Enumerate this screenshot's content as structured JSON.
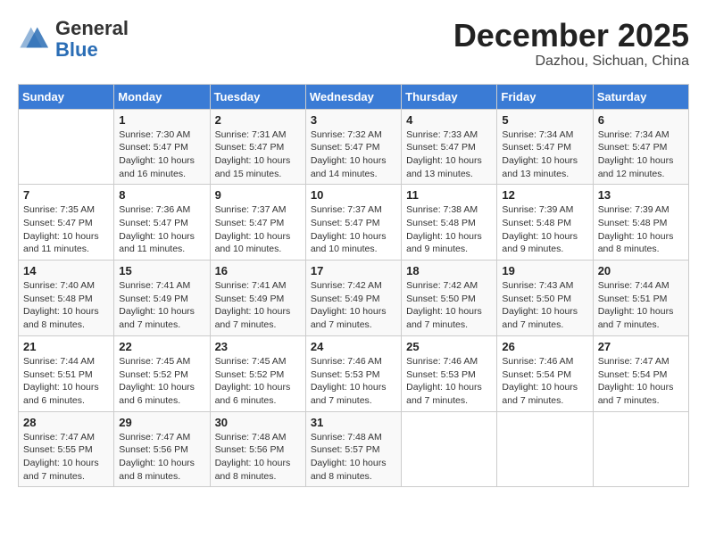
{
  "header": {
    "logo_line1": "General",
    "logo_line2": "Blue",
    "month": "December 2025",
    "location": "Dazhou, Sichuan, China"
  },
  "weekdays": [
    "Sunday",
    "Monday",
    "Tuesday",
    "Wednesday",
    "Thursday",
    "Friday",
    "Saturday"
  ],
  "weeks": [
    [
      {
        "day": "",
        "sunrise": "",
        "sunset": "",
        "daylight": ""
      },
      {
        "day": "1",
        "sunrise": "Sunrise: 7:30 AM",
        "sunset": "Sunset: 5:47 PM",
        "daylight": "Daylight: 10 hours and 16 minutes."
      },
      {
        "day": "2",
        "sunrise": "Sunrise: 7:31 AM",
        "sunset": "Sunset: 5:47 PM",
        "daylight": "Daylight: 10 hours and 15 minutes."
      },
      {
        "day": "3",
        "sunrise": "Sunrise: 7:32 AM",
        "sunset": "Sunset: 5:47 PM",
        "daylight": "Daylight: 10 hours and 14 minutes."
      },
      {
        "day": "4",
        "sunrise": "Sunrise: 7:33 AM",
        "sunset": "Sunset: 5:47 PM",
        "daylight": "Daylight: 10 hours and 13 minutes."
      },
      {
        "day": "5",
        "sunrise": "Sunrise: 7:34 AM",
        "sunset": "Sunset: 5:47 PM",
        "daylight": "Daylight: 10 hours and 13 minutes."
      },
      {
        "day": "6",
        "sunrise": "Sunrise: 7:34 AM",
        "sunset": "Sunset: 5:47 PM",
        "daylight": "Daylight: 10 hours and 12 minutes."
      }
    ],
    [
      {
        "day": "7",
        "sunrise": "Sunrise: 7:35 AM",
        "sunset": "Sunset: 5:47 PM",
        "daylight": "Daylight: 10 hours and 11 minutes."
      },
      {
        "day": "8",
        "sunrise": "Sunrise: 7:36 AM",
        "sunset": "Sunset: 5:47 PM",
        "daylight": "Daylight: 10 hours and 11 minutes."
      },
      {
        "day": "9",
        "sunrise": "Sunrise: 7:37 AM",
        "sunset": "Sunset: 5:47 PM",
        "daylight": "Daylight: 10 hours and 10 minutes."
      },
      {
        "day": "10",
        "sunrise": "Sunrise: 7:37 AM",
        "sunset": "Sunset: 5:47 PM",
        "daylight": "Daylight: 10 hours and 10 minutes."
      },
      {
        "day": "11",
        "sunrise": "Sunrise: 7:38 AM",
        "sunset": "Sunset: 5:48 PM",
        "daylight": "Daylight: 10 hours and 9 minutes."
      },
      {
        "day": "12",
        "sunrise": "Sunrise: 7:39 AM",
        "sunset": "Sunset: 5:48 PM",
        "daylight": "Daylight: 10 hours and 9 minutes."
      },
      {
        "day": "13",
        "sunrise": "Sunrise: 7:39 AM",
        "sunset": "Sunset: 5:48 PM",
        "daylight": "Daylight: 10 hours and 8 minutes."
      }
    ],
    [
      {
        "day": "14",
        "sunrise": "Sunrise: 7:40 AM",
        "sunset": "Sunset: 5:48 PM",
        "daylight": "Daylight: 10 hours and 8 minutes."
      },
      {
        "day": "15",
        "sunrise": "Sunrise: 7:41 AM",
        "sunset": "Sunset: 5:49 PM",
        "daylight": "Daylight: 10 hours and 7 minutes."
      },
      {
        "day": "16",
        "sunrise": "Sunrise: 7:41 AM",
        "sunset": "Sunset: 5:49 PM",
        "daylight": "Daylight: 10 hours and 7 minutes."
      },
      {
        "day": "17",
        "sunrise": "Sunrise: 7:42 AM",
        "sunset": "Sunset: 5:49 PM",
        "daylight": "Daylight: 10 hours and 7 minutes."
      },
      {
        "day": "18",
        "sunrise": "Sunrise: 7:42 AM",
        "sunset": "Sunset: 5:50 PM",
        "daylight": "Daylight: 10 hours and 7 minutes."
      },
      {
        "day": "19",
        "sunrise": "Sunrise: 7:43 AM",
        "sunset": "Sunset: 5:50 PM",
        "daylight": "Daylight: 10 hours and 7 minutes."
      },
      {
        "day": "20",
        "sunrise": "Sunrise: 7:44 AM",
        "sunset": "Sunset: 5:51 PM",
        "daylight": "Daylight: 10 hours and 7 minutes."
      }
    ],
    [
      {
        "day": "21",
        "sunrise": "Sunrise: 7:44 AM",
        "sunset": "Sunset: 5:51 PM",
        "daylight": "Daylight: 10 hours and 6 minutes."
      },
      {
        "day": "22",
        "sunrise": "Sunrise: 7:45 AM",
        "sunset": "Sunset: 5:52 PM",
        "daylight": "Daylight: 10 hours and 6 minutes."
      },
      {
        "day": "23",
        "sunrise": "Sunrise: 7:45 AM",
        "sunset": "Sunset: 5:52 PM",
        "daylight": "Daylight: 10 hours and 6 minutes."
      },
      {
        "day": "24",
        "sunrise": "Sunrise: 7:46 AM",
        "sunset": "Sunset: 5:53 PM",
        "daylight": "Daylight: 10 hours and 7 minutes."
      },
      {
        "day": "25",
        "sunrise": "Sunrise: 7:46 AM",
        "sunset": "Sunset: 5:53 PM",
        "daylight": "Daylight: 10 hours and 7 minutes."
      },
      {
        "day": "26",
        "sunrise": "Sunrise: 7:46 AM",
        "sunset": "Sunset: 5:54 PM",
        "daylight": "Daylight: 10 hours and 7 minutes."
      },
      {
        "day": "27",
        "sunrise": "Sunrise: 7:47 AM",
        "sunset": "Sunset: 5:54 PM",
        "daylight": "Daylight: 10 hours and 7 minutes."
      }
    ],
    [
      {
        "day": "28",
        "sunrise": "Sunrise: 7:47 AM",
        "sunset": "Sunset: 5:55 PM",
        "daylight": "Daylight: 10 hours and 7 minutes."
      },
      {
        "day": "29",
        "sunrise": "Sunrise: 7:47 AM",
        "sunset": "Sunset: 5:56 PM",
        "daylight": "Daylight: 10 hours and 8 minutes."
      },
      {
        "day": "30",
        "sunrise": "Sunrise: 7:48 AM",
        "sunset": "Sunset: 5:56 PM",
        "daylight": "Daylight: 10 hours and 8 minutes."
      },
      {
        "day": "31",
        "sunrise": "Sunrise: 7:48 AM",
        "sunset": "Sunset: 5:57 PM",
        "daylight": "Daylight: 10 hours and 8 minutes."
      },
      {
        "day": "",
        "sunrise": "",
        "sunset": "",
        "daylight": ""
      },
      {
        "day": "",
        "sunrise": "",
        "sunset": "",
        "daylight": ""
      },
      {
        "day": "",
        "sunrise": "",
        "sunset": "",
        "daylight": ""
      }
    ]
  ]
}
